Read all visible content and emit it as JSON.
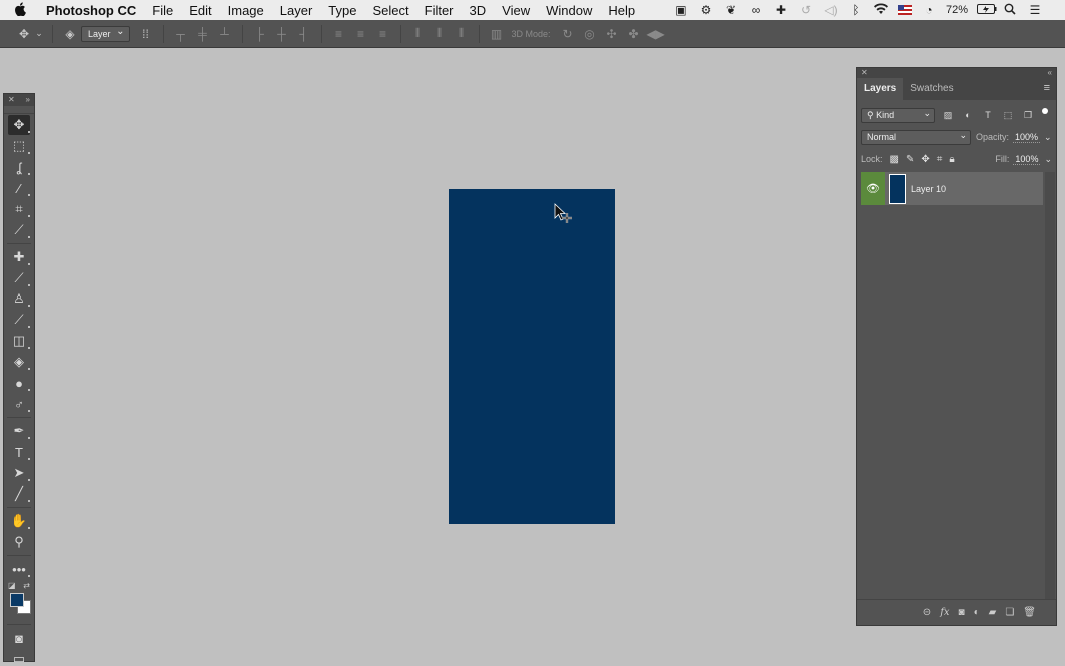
{
  "menubar": {
    "apple": "",
    "app_name": "Photoshop CC",
    "items": [
      "File",
      "Edit",
      "Image",
      "Layer",
      "Type",
      "Select",
      "Filter",
      "3D",
      "View",
      "Window",
      "Help"
    ],
    "status": {
      "battery": "72%"
    }
  },
  "options_bar": {
    "auto_select_target": "Layer",
    "mode_3d_label": "3D Mode:"
  },
  "canvas": {
    "fill_color": "#04335e"
  },
  "colors": {
    "foreground": "#0b3a66",
    "background": "#ffffff"
  },
  "layers_panel": {
    "tabs": [
      "Layers",
      "Swatches"
    ],
    "filter_kind": "Kind",
    "blend_mode": "Normal",
    "opacity_label": "Opacity:",
    "opacity_value": "100%",
    "lock_label": "Lock:",
    "fill_label": "Fill:",
    "fill_value": "100%",
    "layers": [
      {
        "name": "Layer 10",
        "visible": true,
        "thumb_color": "#04335e"
      }
    ]
  }
}
